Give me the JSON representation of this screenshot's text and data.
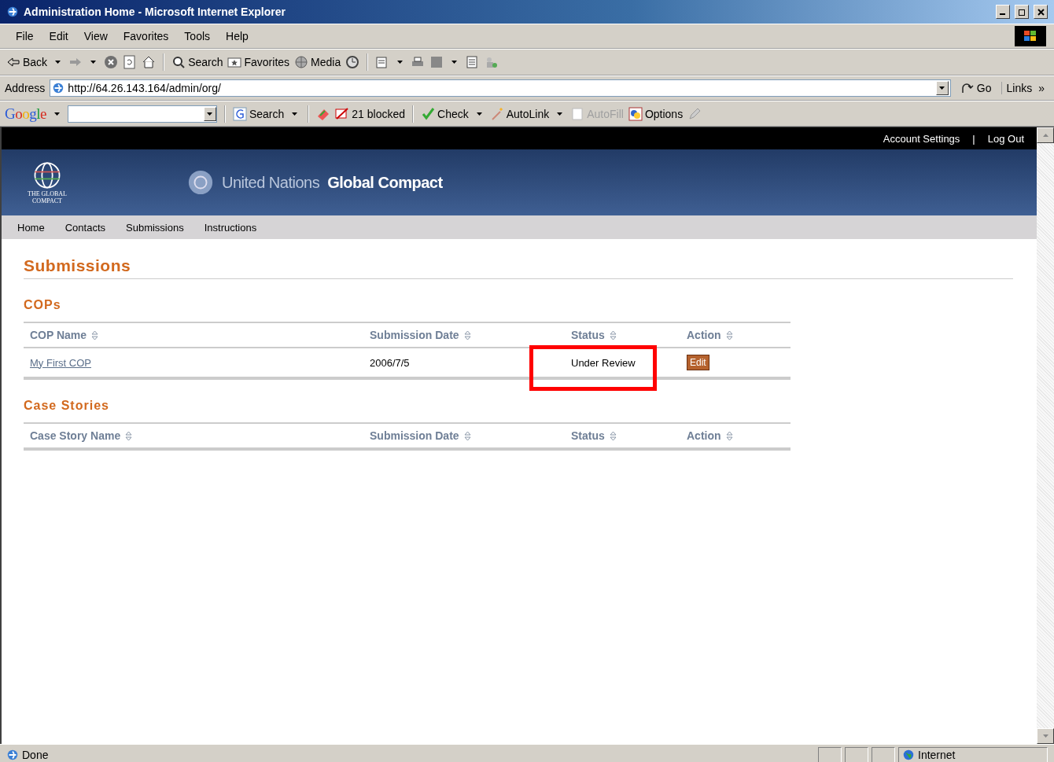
{
  "window": {
    "title": "Administration Home - Microsoft Internet Explorer"
  },
  "menu": [
    "File",
    "Edit",
    "View",
    "Favorites",
    "Tools",
    "Help"
  ],
  "toolbar": {
    "back": "Back",
    "search": "Search",
    "favorites": "Favorites",
    "media": "Media"
  },
  "address_bar": {
    "label": "Address",
    "url": "http://64.26.143.164/admin/org/",
    "go": "Go",
    "links": "Links",
    "more": "»"
  },
  "google_toolbar": {
    "logo": "Google",
    "search": "Search",
    "blocked": "21 blocked",
    "check": "Check",
    "autolink": "AutoLink",
    "autofill": {
      "label": "AutoFill",
      "disabled": true
    },
    "options": "Options"
  },
  "page": {
    "top_links": [
      "Account Settings",
      "Log Out"
    ],
    "separator": "|",
    "banner": {
      "logo_text": "THE GLOBAL COMPACT",
      "title_light": "United Nations",
      "title_bold": "Global Compact"
    },
    "nav": [
      "Home",
      "Contacts",
      "Submissions",
      "Instructions"
    ],
    "heading": "Submissions",
    "sections": [
      {
        "title": "COPs",
        "columns": [
          "COP Name",
          "Submission Date",
          "Status",
          "Action"
        ],
        "rows": [
          {
            "name": "My First COP",
            "date": "2006/7/5",
            "status": "Under Review",
            "highlighted": true,
            "action": "Edit"
          }
        ]
      },
      {
        "title": "Case Stories",
        "columns": [
          "Case Story Name",
          "Submission Date",
          "Status",
          "Action"
        ]
      }
    ]
  },
  "status_bar": {
    "text": "Done",
    "zone": "Internet"
  }
}
